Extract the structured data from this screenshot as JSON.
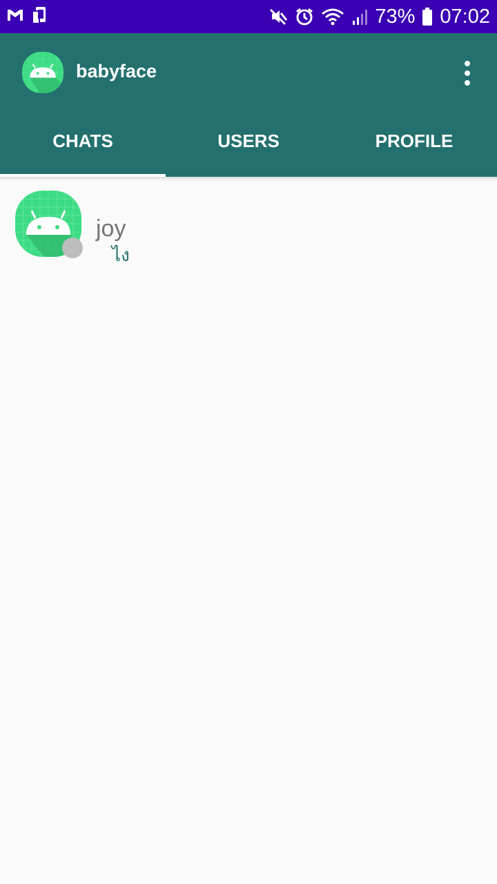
{
  "status_bar": {
    "battery": "73%",
    "time": "07:02",
    "icons": [
      "gmail-icon",
      "screen-mirror-icon",
      "mute-icon",
      "alarm-icon",
      "wifi-icon",
      "signal-icon",
      "battery-icon"
    ]
  },
  "app_bar": {
    "title": "babyface",
    "menu_icon": "more-vertical-icon"
  },
  "tabs": [
    {
      "label": "CHATS",
      "selected": true
    },
    {
      "label": "USERS",
      "selected": false
    },
    {
      "label": "PROFILE",
      "selected": false
    }
  ],
  "chats": [
    {
      "name": "joy",
      "last_message": "ไง",
      "presence": "offline"
    }
  ],
  "colors": {
    "status_bar": "#3b00b3",
    "primary": "#23706e",
    "background": "#fafafa",
    "avatar_green": "#3ddc84",
    "presence_offline": "#bdbdbd"
  }
}
